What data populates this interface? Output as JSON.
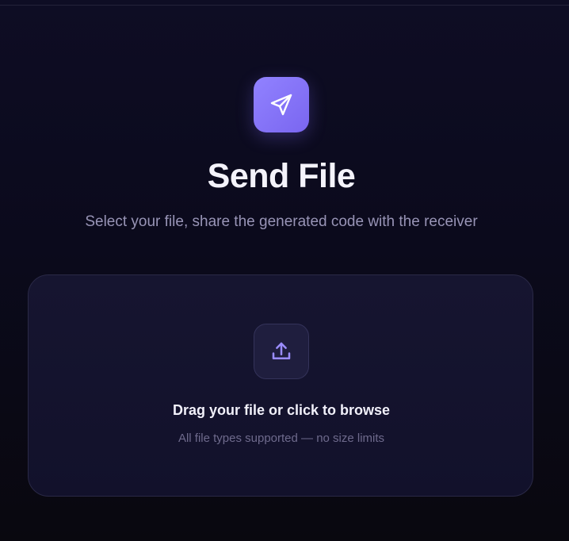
{
  "header": {
    "icon": "send-icon",
    "title": "Send File",
    "subtitle": "Select your file, share the generated code with the receiver"
  },
  "dropzone": {
    "icon": "upload-icon",
    "title": "Drag your file or click to browse",
    "hint": "All file types supported — no size limits"
  },
  "colors": {
    "accent": "#8b7cf8",
    "background": "#0c0b1e",
    "card": "#14132d"
  }
}
